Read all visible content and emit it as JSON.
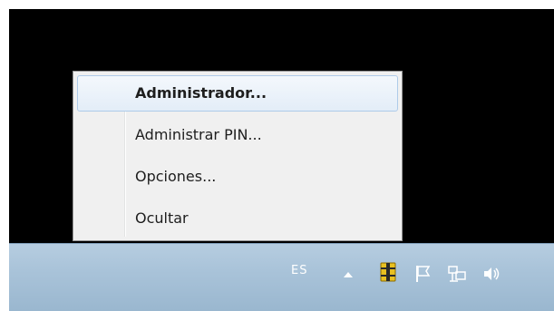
{
  "context_menu": {
    "items": [
      {
        "label": "Administrador...",
        "bold": true,
        "highlighted": true
      },
      {
        "label": "Administrar PIN...",
        "bold": false,
        "highlighted": false
      },
      {
        "label": "Opciones...",
        "bold": false,
        "highlighted": false
      },
      {
        "label": "Ocultar",
        "bold": false,
        "highlighted": false
      }
    ]
  },
  "taskbar": {
    "language_indicator": "ES",
    "tray_icons": [
      "show-hidden-icons-arrow-icon",
      "smart-card-chip-icon",
      "action-center-flag-icon",
      "network-icon",
      "volume-speaker-icon"
    ]
  },
  "colors": {
    "desktop": "#000000",
    "taskbar": "#a9c3d9",
    "menu_background": "#f0f0f0",
    "highlight_border": "#aecbe9",
    "chip_gold": "#e8c020"
  }
}
